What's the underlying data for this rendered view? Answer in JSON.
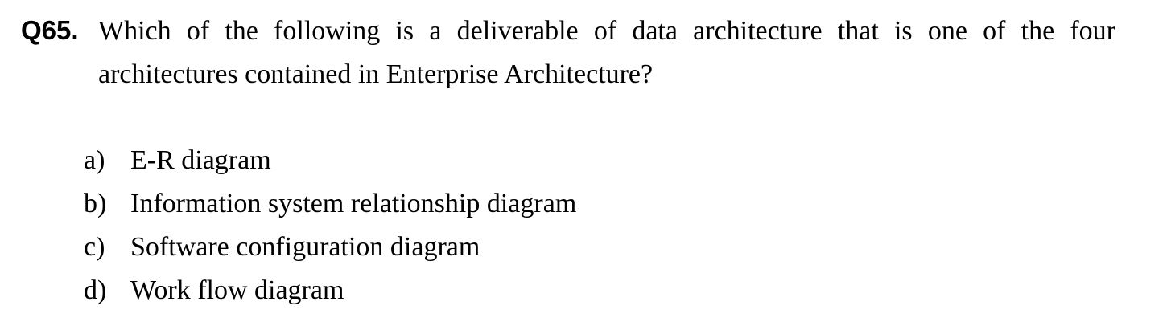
{
  "question": {
    "number": "Q65.",
    "text": "Which of the following is a deliverable of data architecture that is one of the four architectures contained in Enterprise Architecture?"
  },
  "options": [
    {
      "letter": "a)",
      "text": "E-R diagram"
    },
    {
      "letter": "b)",
      "text": "Information system relationship diagram"
    },
    {
      "letter": "c)",
      "text": "Software configuration diagram"
    },
    {
      "letter": "d)",
      "text": "Work flow diagram"
    }
  ]
}
